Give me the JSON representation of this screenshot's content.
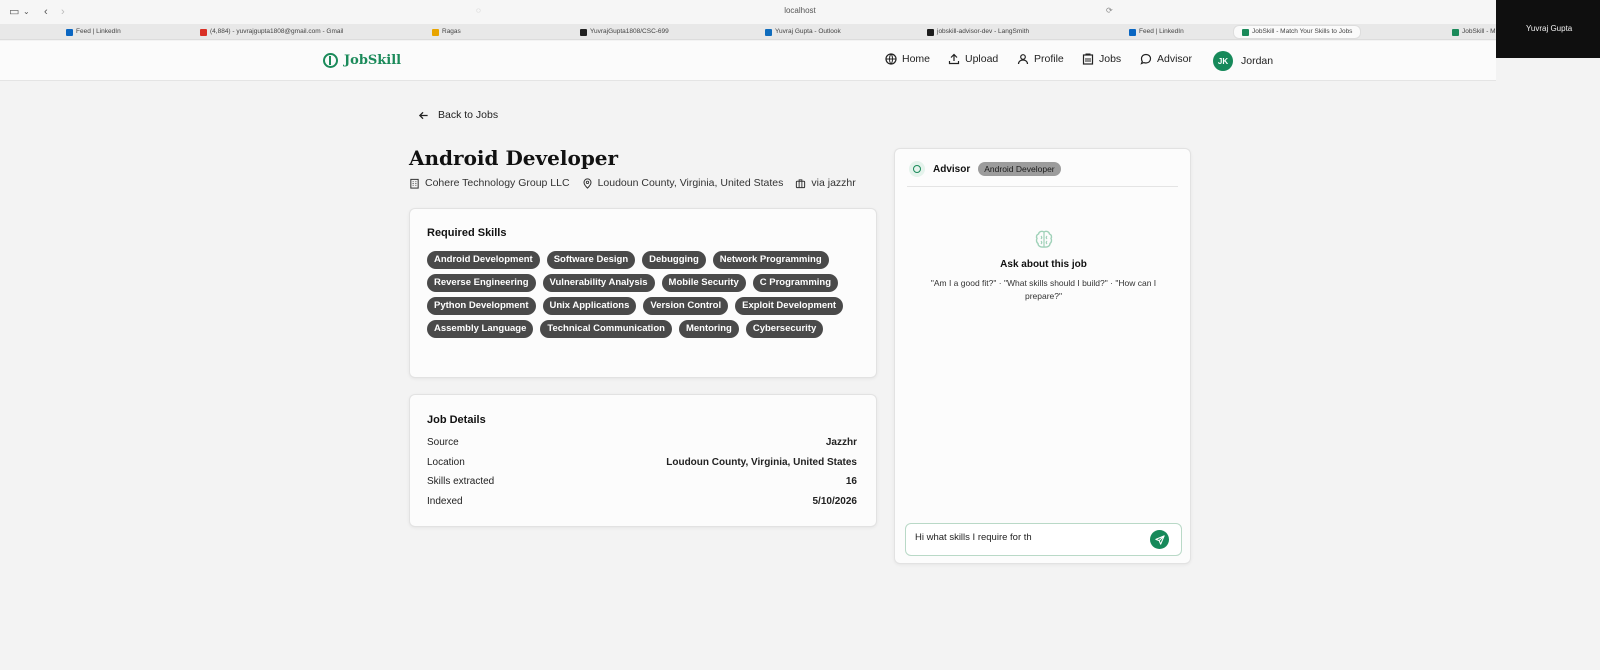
{
  "browser": {
    "url": "localhost",
    "tabs": [
      {
        "label": "Feed | LinkedIn",
        "icon": "linkedin-icon",
        "color": "#0a66c2"
      },
      {
        "label": "(4,884) - yuvrajgupta1808@gmail.com - Gmail",
        "icon": "gmail-icon",
        "color": "#d93025"
      },
      {
        "label": "Ragas",
        "icon": "ragas-icon",
        "color": "#e8a400"
      },
      {
        "label": "YuvrajGupta1808/CSC-699",
        "icon": "github-icon",
        "color": "#222222"
      },
      {
        "label": "Yuvraj Gupta - Outlook",
        "icon": "outlook-icon",
        "color": "#0f6cbd"
      },
      {
        "label": "jobskill-advisor-dev - LangSmith",
        "icon": "langsmith-icon",
        "color": "#1c1c1c"
      },
      {
        "label": "Feed | LinkedIn",
        "icon": "linkedin-icon",
        "color": "#0a66c2"
      },
      {
        "label": "JobSkill - Match Your Skills to Jobs",
        "icon": "jobskill-icon",
        "color": "#1b8a5a"
      },
      {
        "label": "JobSkill - M",
        "icon": "jobskill-icon",
        "color": "#1b8a5a"
      }
    ],
    "profile_name": "Yuvraj Gupta"
  },
  "header": {
    "brand": "JobSkill",
    "nav": {
      "home": "Home",
      "upload": "Upload",
      "profile": "Profile",
      "jobs": "Jobs",
      "advisor": "Advisor"
    },
    "user": {
      "initials": "JK",
      "name": "Jordan"
    }
  },
  "page": {
    "back_label": "Back to Jobs",
    "title": "Android Developer",
    "company": "Cohere Technology Group LLC",
    "location": "Loudoun County, Virginia, United States",
    "source": "via jazzhr"
  },
  "skills": {
    "title": "Required Skills",
    "items": [
      "Android Development",
      "Software Design",
      "Debugging",
      "Network Programming",
      "Reverse Engineering",
      "Vulnerability Analysis",
      "Mobile Security",
      "C Programming",
      "Python Development",
      "Unix Applications",
      "Version Control",
      "Exploit Development",
      "Assembly Language",
      "Technical Communication",
      "Mentoring",
      "Cybersecurity"
    ]
  },
  "details": {
    "title": "Job Details",
    "rows": [
      {
        "label": "Source",
        "value": "Jazzhr"
      },
      {
        "label": "Location",
        "value": "Loudoun County, Virginia, United States"
      },
      {
        "label": "Skills extracted",
        "value": "16"
      },
      {
        "label": "Indexed",
        "value": "5/10/2026"
      }
    ]
  },
  "advisor": {
    "title": "Advisor",
    "badge": "Android Developer",
    "empty_title": "Ask about this job",
    "empty_hint": "\"Am I a good fit?\" · \"What skills should I build?\" · \"How can I prepare?\"",
    "input_value": "Hi what skills I require for th"
  },
  "colors": {
    "accent": "#16895a",
    "chip": "#4a4a4a"
  }
}
